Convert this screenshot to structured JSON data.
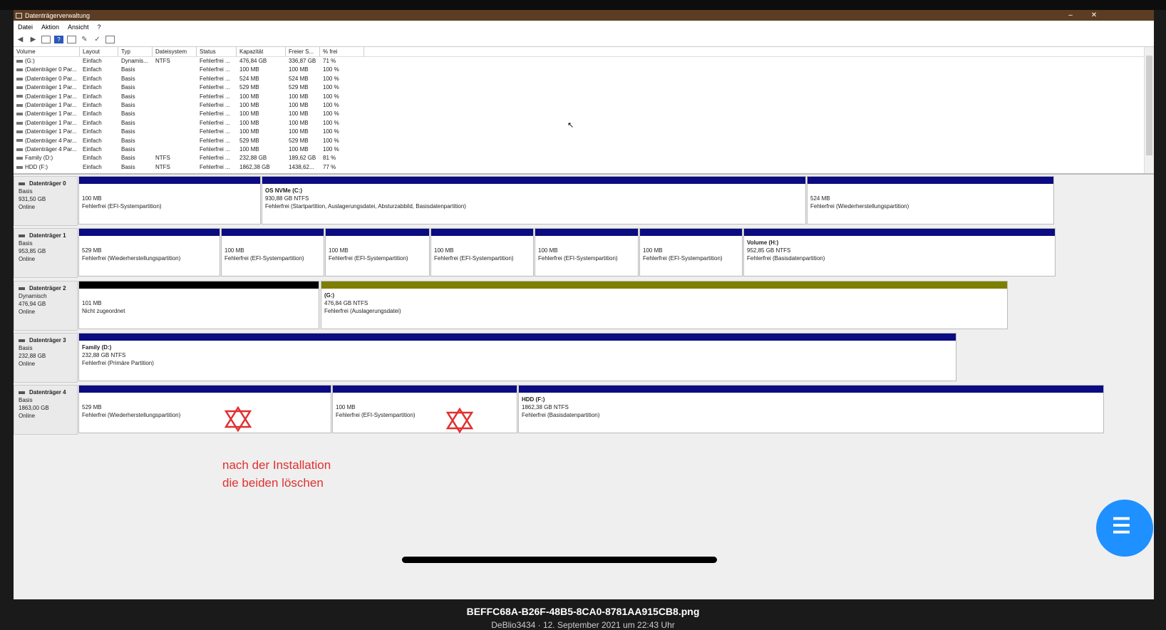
{
  "window": {
    "title": "Datenträgerverwaltung",
    "min_label": "–",
    "close_label": "✕"
  },
  "menu": [
    "Datei",
    "Aktion",
    "Ansicht",
    "?"
  ],
  "table": {
    "headers": [
      "Volume",
      "Layout",
      "Typ",
      "Dateisystem",
      "Status",
      "Kapazität",
      "Freier S...",
      "% frei"
    ],
    "rows": [
      [
        "(G:)",
        "Einfach",
        "Dynamis...",
        "NTFS",
        "Fehlerfrei ...",
        "476,84 GB",
        "336,87 GB",
        "71 %"
      ],
      [
        "(Datenträger 0 Par...",
        "Einfach",
        "Basis",
        "",
        "Fehlerfrei ...",
        "100 MB",
        "100 MB",
        "100 %"
      ],
      [
        "(Datenträger 0 Par...",
        "Einfach",
        "Basis",
        "",
        "Fehlerfrei ...",
        "524 MB",
        "524 MB",
        "100 %"
      ],
      [
        "(Datenträger 1 Par...",
        "Einfach",
        "Basis",
        "",
        "Fehlerfrei ...",
        "529 MB",
        "529 MB",
        "100 %"
      ],
      [
        "(Datenträger 1 Par...",
        "Einfach",
        "Basis",
        "",
        "Fehlerfrei ...",
        "100 MB",
        "100 MB",
        "100 %"
      ],
      [
        "(Datenträger 1 Par...",
        "Einfach",
        "Basis",
        "",
        "Fehlerfrei ...",
        "100 MB",
        "100 MB",
        "100 %"
      ],
      [
        "(Datenträger 1 Par...",
        "Einfach",
        "Basis",
        "",
        "Fehlerfrei ...",
        "100 MB",
        "100 MB",
        "100 %"
      ],
      [
        "(Datenträger 1 Par...",
        "Einfach",
        "Basis",
        "",
        "Fehlerfrei ...",
        "100 MB",
        "100 MB",
        "100 %"
      ],
      [
        "(Datenträger 1 Par...",
        "Einfach",
        "Basis",
        "",
        "Fehlerfrei ...",
        "100 MB",
        "100 MB",
        "100 %"
      ],
      [
        "(Datenträger 4 Par...",
        "Einfach",
        "Basis",
        "",
        "Fehlerfrei ...",
        "529 MB",
        "529 MB",
        "100 %"
      ],
      [
        "(Datenträger 4 Par...",
        "Einfach",
        "Basis",
        "",
        "Fehlerfrei ...",
        "100 MB",
        "100 MB",
        "100 %"
      ],
      [
        "Family (D:)",
        "Einfach",
        "Basis",
        "NTFS",
        "Fehlerfrei ...",
        "232,88 GB",
        "189,62 GB",
        "81 %"
      ],
      [
        "HDD (F:)",
        "Einfach",
        "Basis",
        "NTFS",
        "Fehlerfrei ...",
        "1862,38 GB",
        "1438,62...",
        "77 %"
      ]
    ]
  },
  "disks": [
    {
      "name": "Datenträger 0",
      "type": "Basis",
      "size": "931,50 GB",
      "state": "Online",
      "partitions": [
        {
          "name": "",
          "size": "100 MB",
          "status": "Fehlerfrei (EFI-Systempartition)",
          "bar": "blue"
        },
        {
          "name": "OS NVMe  (C:)",
          "size": "930,88 GB NTFS",
          "status": "Fehlerfrei (Startpartition, Auslagerungsdatei, Absturzabbild, Basisdatenpartition)",
          "bar": "blue"
        },
        {
          "name": "",
          "size": "524 MB",
          "status": "Fehlerfrei (Wiederherstellungspartition)",
          "bar": "blue"
        }
      ]
    },
    {
      "name": "Datenträger 1",
      "type": "Basis",
      "size": "953,85 GB",
      "state": "Online",
      "partitions": [
        {
          "name": "",
          "size": "529 MB",
          "status": "Fehlerfrei (Wiederherstellungspartition)",
          "bar": "blue"
        },
        {
          "name": "",
          "size": "100 MB",
          "status": "Fehlerfrei (EFI-Systempartition)",
          "bar": "blue"
        },
        {
          "name": "",
          "size": "100 MB",
          "status": "Fehlerfrei (EFI-Systempartition)",
          "bar": "blue"
        },
        {
          "name": "",
          "size": "100 MB",
          "status": "Fehlerfrei (EFI-Systempartition)",
          "bar": "blue"
        },
        {
          "name": "",
          "size": "100 MB",
          "status": "Fehlerfrei (EFI-Systempartition)",
          "bar": "blue"
        },
        {
          "name": "",
          "size": "100 MB",
          "status": "Fehlerfrei (EFI-Systempartition)",
          "bar": "blue"
        },
        {
          "name": "Volume  (H:)",
          "size": "952,85 GB NTFS",
          "status": "Fehlerfrei (Basisdatenpartition)",
          "bar": "blue"
        }
      ]
    },
    {
      "name": "Datenträger 2",
      "type": "Dynamisch",
      "size": "476,94 GB",
      "state": "Online",
      "partitions": [
        {
          "name": "",
          "size": "101 MB",
          "status": "Nicht zugeordnet",
          "bar": "black"
        },
        {
          "name": "(G:)",
          "size": "476,84 GB NTFS",
          "status": "Fehlerfrei (Auslagerungsdatei)",
          "bar": "olive"
        }
      ]
    },
    {
      "name": "Datenträger 3",
      "type": "Basis",
      "size": "232,88 GB",
      "state": "Online",
      "partitions": [
        {
          "name": "Family  (D:)",
          "size": "232,88 GB NTFS",
          "status": "Fehlerfrei (Primäre Partition)",
          "bar": "blue"
        }
      ]
    },
    {
      "name": "Datenträger 4",
      "type": "Basis",
      "size": "1863,00 GB",
      "state": "Online",
      "partitions": [
        {
          "name": "",
          "size": "529 MB",
          "status": "Fehlerfrei (Wiederherstellungspartition)",
          "bar": "blue"
        },
        {
          "name": "",
          "size": "100 MB",
          "status": "Fehlerfrei (EFI-Systempartition)",
          "bar": "blue"
        },
        {
          "name": "HDD  (F:)",
          "size": "1862,38 GB NTFS",
          "status": "Fehlerfrei (Basisdatenpartition)",
          "bar": "blue"
        }
      ]
    }
  ],
  "annotation": {
    "line1": "nach der Installation",
    "line2": "die beiden löschen",
    "color": "#e03030"
  },
  "caption": {
    "filename": "BEFFC68A-B26F-48B5-8CA0-8781AA915CB8.png",
    "subtitle": "DeBlio3434 · 12. September 2021 um 22:43 Uhr"
  },
  "colors": {
    "titlebar": "#5c3d23",
    "partition_blue": "#0b0b82",
    "unallocated": "#000000",
    "dynamic_volume": "#7e7e00",
    "fab": "#1e90ff"
  },
  "icons": [
    "back-arrow-icon",
    "forward-arrow-icon",
    "list-view-icon",
    "help-icon",
    "details-icon",
    "connect-icon",
    "check-icon",
    "properties-icon",
    "star-of-david-icon",
    "menu-icon"
  ]
}
